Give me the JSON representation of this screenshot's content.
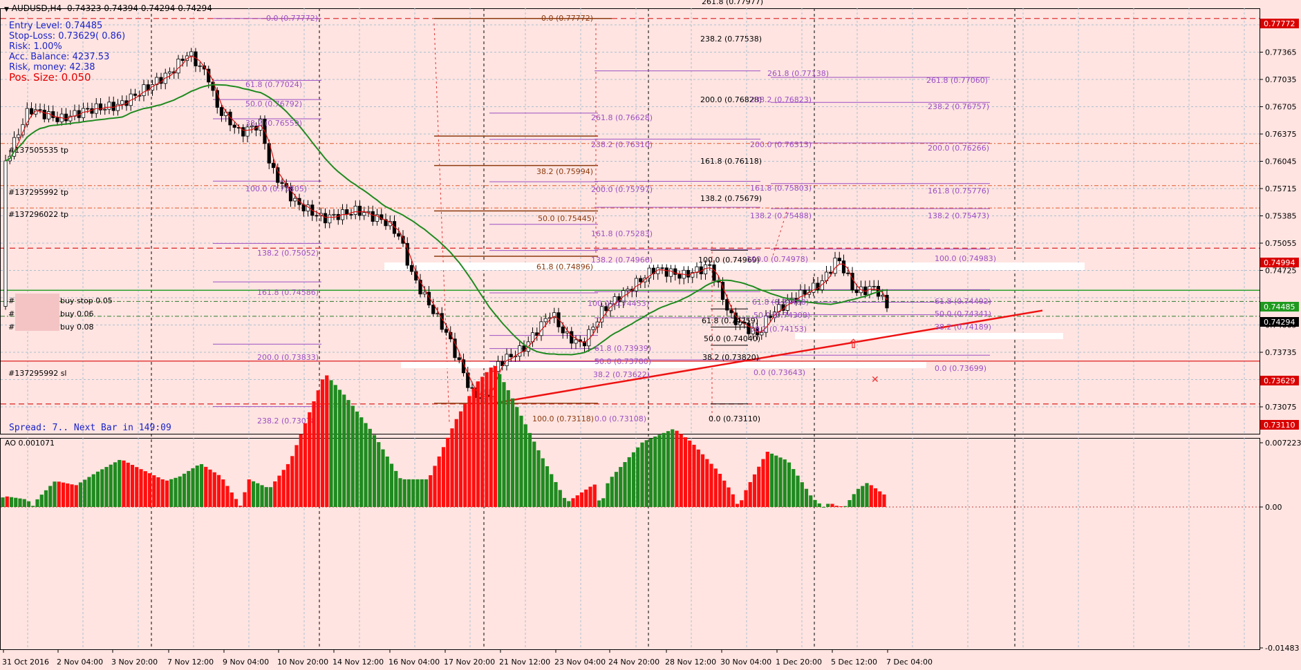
{
  "header": {
    "symbol": "AUDUSD,H4",
    "ohlc": "0.74323 0.74394 0.74294 0.74294"
  },
  "position_info": {
    "entry": "Entry Level:   0.74485",
    "stop": "Stop-Loss:   0.73629( 0.86)",
    "risk": "Risk:      1.00%",
    "balance": "Acc. Balance: 4237.53",
    "risk_money": "Risk, money:  42.38",
    "pos_size": "Pos. Size:    0.050"
  },
  "spread_text": "Spread: 7.. Next Bar in 149:09",
  "price_axis": {
    "ticks": [
      "0.77695",
      "0.77365",
      "0.77035",
      "0.76705",
      "0.76375",
      "0.76045",
      "0.75715",
      "0.75385",
      "0.75055",
      "0.74725",
      "0.74395",
      "0.74065",
      "0.73735",
      "0.73405",
      "0.73075"
    ],
    "tags": [
      {
        "text": "0.77772",
        "bg": "#d90000",
        "fg": "#ffffff"
      },
      {
        "text": "0.74994",
        "bg": "#d90000",
        "fg": "#ffffff"
      },
      {
        "text": "0.74485",
        "bg": "#1f9a1f",
        "fg": "#ffffff"
      },
      {
        "text": "0.74294",
        "bg": "#000000",
        "fg": "#ffffff"
      },
      {
        "text": "0.73629",
        "bg": "#d90000",
        "fg": "#ffffff"
      },
      {
        "text": "0.73110",
        "bg": "#d90000",
        "fg": "#ffffff"
      }
    ],
    "ticks_behind_tags": [
      "0.74395"
    ]
  },
  "ao_axis": {
    "label": "AO 0.001071",
    "ticks": [
      "0.007223",
      "0.00",
      "-0.01483"
    ]
  },
  "time_axis": [
    "31 Oct 2016",
    "2 Nov 04:00",
    "3 Nov 20:00",
    "7 Nov 12:00",
    "9 Nov 04:00",
    "10 Nov 20:00",
    "14 Nov 12:00",
    "16 Nov 04:00",
    "17 Nov 20:00",
    "21 Nov 12:00",
    "23 Nov 04:00",
    "24 Nov 20:00",
    "28 Nov 12:00",
    "30 Nov 04:00",
    "1 Dec 20:00",
    "5 Dec 12:00",
    "7 Dec 04:00"
  ],
  "order_labels": [
    {
      "text": "#137505535 tp"
    },
    {
      "text": "#137295992 tp"
    },
    {
      "text": "#137296022 tp"
    },
    {
      "text": "buy stop 0.05"
    },
    {
      "text": "buy 0.06"
    },
    {
      "text": "buy 0.08"
    },
    {
      "text": "#137295992 sl"
    }
  ],
  "fib_labels": [
    {
      "text": "0.0  (0.77772)",
      "c": "#9b4fc4"
    },
    {
      "text": "61.8 (0.77024)",
      "c": "#9b4fc4"
    },
    {
      "text": "50.0 (0.76792)",
      "c": "#9b4fc4"
    },
    {
      "text": "38.2 (0.76559)",
      "c": "#9b4fc4"
    },
    {
      "text": "100.0 (0.75805)",
      "c": "#9b4fc4"
    },
    {
      "text": "138.2 (0.75052)",
      "c": "#9b4fc4"
    },
    {
      "text": "161.8 (0.74586)",
      "c": "#9b4fc4"
    },
    {
      "text": "200.0 (0.73833)",
      "c": "#9b4fc4"
    },
    {
      "text": "238.2 (0.73078)",
      "c": "#9b4fc4"
    },
    {
      "text": "0.0  (0.77772)",
      "c": "#8b3a0e"
    },
    {
      "text": "38.2  (0.75994)",
      "c": "#8b3a0e"
    },
    {
      "text": "50.0  (0.75445)",
      "c": "#8b3a0e"
    },
    {
      "text": "61.8  (0.74896)",
      "c": "#8b3a0e"
    },
    {
      "text": "100.0  (0.73118)",
      "c": "#8b3a0e"
    },
    {
      "text": "261.8 (0.76628)",
      "c": "#9b4fc4"
    },
    {
      "text": "238.2 (0.76310)",
      "c": "#9b4fc4"
    },
    {
      "text": "200.0 (0.75797)",
      "c": "#9b4fc4"
    },
    {
      "text": "161.8 (0.75283)",
      "c": "#9b4fc4"
    },
    {
      "text": "138.2 (0.74966)",
      "c": "#9b4fc4"
    },
    {
      "text": "100.0 (0.74453)",
      "c": "#9b4fc4"
    },
    {
      "text": "61.8 (0.73939)",
      "c": "#9b4fc4"
    },
    {
      "text": "50.0 (0.73780)",
      "c": "#9b4fc4"
    },
    {
      "text": "38.2 (0.73622)",
      "c": "#9b4fc4"
    },
    {
      "text": "0.0 (0.73108)",
      "c": "#9b4fc4"
    },
    {
      "text": "261.8 (0.77977)",
      "c": "#000000"
    },
    {
      "text": "238.2 (0.77538)",
      "c": "#000000"
    },
    {
      "text": "200.0 (0.76828)",
      "c": "#000000"
    },
    {
      "text": "161.8 (0.76118)",
      "c": "#000000"
    },
    {
      "text": "138.2 (0.75679)",
      "c": "#000000"
    },
    {
      "text": "100.0 (0.74969)",
      "c": "#000000"
    },
    {
      "text": "61.8 (0.74259)",
      "c": "#000000"
    },
    {
      "text": "50.0 (0.74040)",
      "c": "#000000"
    },
    {
      "text": "38.2 (0.73820)",
      "c": "#000000"
    },
    {
      "text": "0.0  (0.73110)",
      "c": "#000000"
    },
    {
      "text": "261.8 (0.77138)",
      "c": "#9b4fc4"
    },
    {
      "text": "238.2 (0.76823)",
      "c": "#9b4fc4"
    },
    {
      "text": "200.0 (0.76313)",
      "c": "#9b4fc4"
    },
    {
      "text": "161.8 (0.75803)",
      "c": "#9b4fc4"
    },
    {
      "text": "138.2 (0.75488)",
      "c": "#9b4fc4"
    },
    {
      "text": "100.0 (0.74978)",
      "c": "#9b4fc4"
    },
    {
      "text": "61.8 (0.74468)",
      "c": "#9b4fc4"
    },
    {
      "text": "50.0 (0.74308)",
      "c": "#9b4fc4"
    },
    {
      "text": "38.2 (0.74153)",
      "c": "#9b4fc4"
    },
    {
      "text": "0.0 (0.73643)",
      "c": "#9b4fc4"
    },
    {
      "text": "261.8 (0.77060)",
      "c": "#9b4fc4"
    },
    {
      "text": "238.2 (0.76757)",
      "c": "#9b4fc4"
    },
    {
      "text": "200.0 (0.76266)",
      "c": "#9b4fc4"
    },
    {
      "text": "161.8 (0.75776)",
      "c": "#9b4fc4"
    },
    {
      "text": "138.2 (0.75473)",
      "c": "#9b4fc4"
    },
    {
      "text": "100.0 (0.74983)",
      "c": "#9b4fc4"
    },
    {
      "text": "61.8 (0.74492)",
      "c": "#9b4fc4"
    },
    {
      "text": "50.0 (0.74341)",
      "c": "#9b4fc4"
    },
    {
      "text": "38.2 (0.74189)",
      "c": "#9b4fc4"
    },
    {
      "text": "0.0 (0.73699)",
      "c": "#9b4fc4"
    }
  ],
  "colors": {
    "background": "#ffe4e1",
    "grid": "#a9bfcf",
    "bull": "#ffffff",
    "bear": "#000000",
    "ma_fast": "#e01010",
    "ma_slow": "#1f8a1f",
    "ao_up": "#1f8a1f",
    "ao_down": "#ff0f0f",
    "trendline": "#ee1111",
    "stop_line": "#e04040",
    "entry_line": "#2ca02c"
  }
}
